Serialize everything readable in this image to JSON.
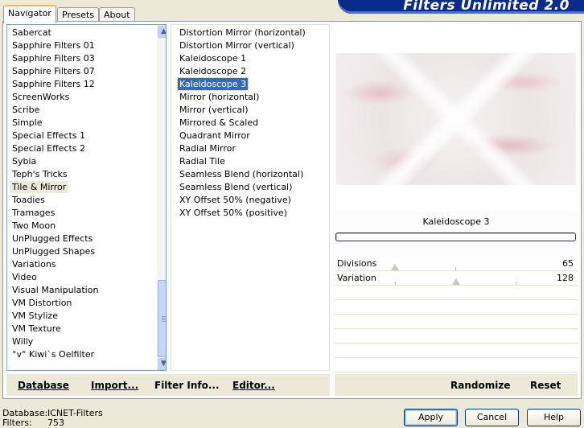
{
  "banner": {
    "title": "Filters Unlimited 2.0"
  },
  "tabs": [
    {
      "label": "Navigator"
    },
    {
      "label": "Presets"
    },
    {
      "label": "About"
    }
  ],
  "categories": {
    "items": [
      "Sabercat",
      "Sapphire Filters 01",
      "Sapphire Filters 03",
      "Sapphire Filters 07",
      "Sapphire Filters 12",
      "ScreenWorks",
      "Scribe",
      "Simple",
      "Special Effects 1",
      "Special Effects 2",
      "Sybia",
      "Teph's Tricks",
      "Tile & Mirror",
      "Toadies",
      "Tramages",
      "Two Moon",
      "UnPlugged Effects",
      "UnPlugged Shapes",
      "Variations",
      "Video",
      "Visual Manipulation",
      "VM Distortion",
      "VM Stylize",
      "VM Texture",
      "Willy",
      "°v° Kiwi`s Oelfilter"
    ],
    "selected": "Tile & Mirror",
    "scroll_up": "▲",
    "scroll_down": "▼"
  },
  "filters": {
    "items": [
      "Distortion Mirror (horizontal)",
      "Distortion Mirror (vertical)",
      "Kaleidoscope 1",
      "Kaleidoscope 2",
      "Kaleidoscope 3",
      "Mirror (horizontal)",
      "Mirror (vertical)",
      "Mirrored & Scaled",
      "Quadrant Mirror",
      "Radial Mirror",
      "Radial Tile",
      "Seamless Blend (horizontal)",
      "Seamless Blend (vertical)",
      "XY Offset 50% (negative)",
      "XY Offset 50% (positive)"
    ],
    "selected": "Kaleidoscope 3"
  },
  "preview": {
    "filter_title": "Kaleidoscope 3"
  },
  "parameters": [
    {
      "name": "Divisions",
      "value": "65"
    },
    {
      "name": "Variation",
      "value": "128"
    }
  ],
  "left_buttons": {
    "database": "Database",
    "import": "Import...",
    "filter_info": "Filter Info...",
    "editor": "Editor..."
  },
  "right_buttons": {
    "randomize": "Randomize",
    "reset": "Reset"
  },
  "status": {
    "database_label": "Database:",
    "database_value": "ICNET-Filters",
    "filters_label": "Filters:",
    "filters_value": "753"
  },
  "dialog_buttons": {
    "apply": "Apply",
    "cancel": "Cancel",
    "help": "Help"
  }
}
